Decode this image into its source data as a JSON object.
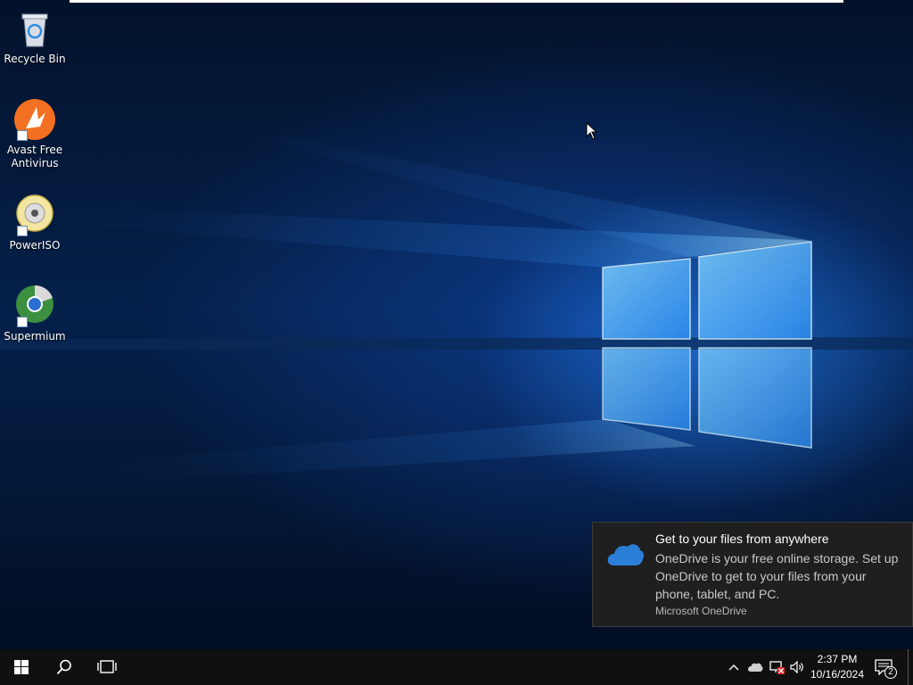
{
  "desktop_icons": [
    {
      "label": "Recycle Bin",
      "icon": "recycle-bin-icon"
    },
    {
      "label": "Avast Free\nAntivirus",
      "line1": "Avast Free",
      "line2": "Antivirus",
      "icon": "avast-icon"
    },
    {
      "label": "PowerISO",
      "icon": "poweriso-icon"
    },
    {
      "label": "Supermium",
      "icon": "supermium-icon"
    }
  ],
  "toast": {
    "title": "Get to your files from anywhere",
    "body": "OneDrive is your free online storage. Set up OneDrive to get to your files from your phone, tablet, and PC.",
    "source": "Microsoft OneDrive",
    "icon": "onedrive-cloud-icon"
  },
  "taskbar": {
    "start_icon": "windows-logo-icon",
    "search_icon": "search-icon",
    "taskview_icon": "task-view-icon",
    "tray": {
      "icons": [
        "chevron-up-icon",
        "onedrive-icon",
        "network-disconnected-icon",
        "volume-icon"
      ],
      "time": "2:37 PM",
      "date": "10/16/2024",
      "notifications_count": "2"
    }
  },
  "colors": {
    "taskbar_bg": "#101010",
    "toast_bg": "#1f1f1f",
    "accent_blue": "#2b7fd9"
  }
}
